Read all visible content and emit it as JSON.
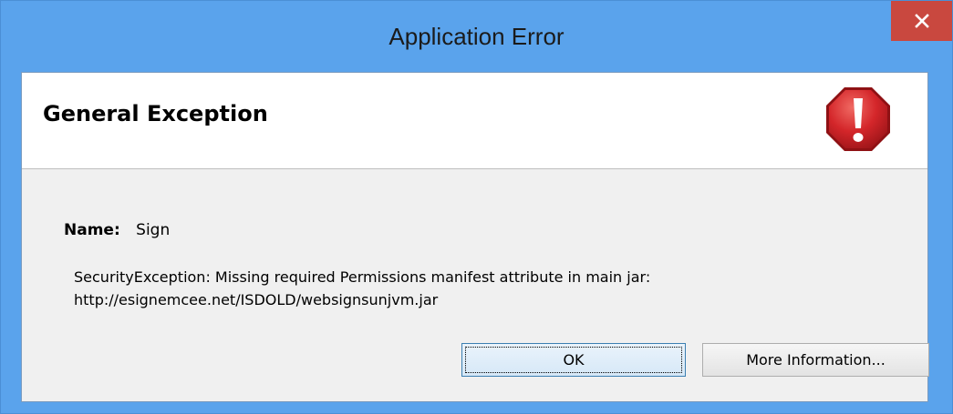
{
  "window": {
    "title": "Application Error"
  },
  "header": {
    "title": "General Exception",
    "icon": "error-stop-icon",
    "icon_color": "#d4262a"
  },
  "details": {
    "name_label": "Name:",
    "name_value": "Sign",
    "message_line1": "SecurityException: Missing required Permissions manifest attribute in main jar:",
    "message_line2": "http://esignemcee.net/ISDOLD/websignsunjvm.jar"
  },
  "buttons": {
    "ok_label": "OK",
    "more_label": "More Information..."
  },
  "colors": {
    "titlebar": "#5aa3ec",
    "close_button": "#c9483f"
  }
}
